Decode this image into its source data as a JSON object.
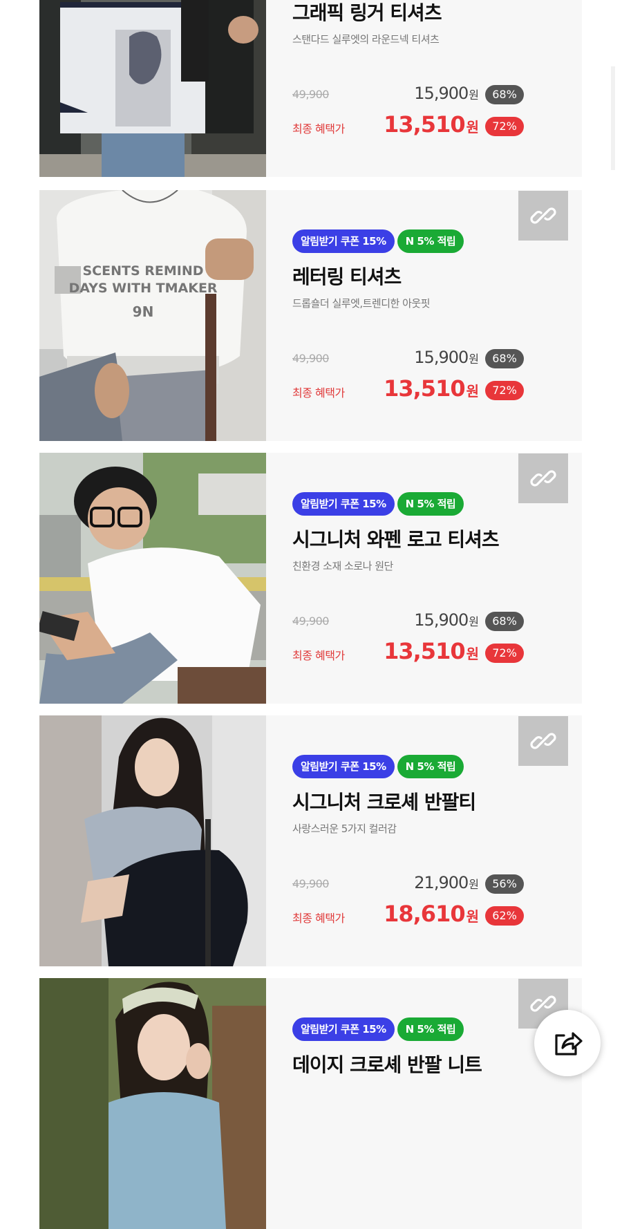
{
  "products": [
    {
      "title": "그래픽 링거 티셔츠",
      "subtitle": "스탠다드 실루엣의 라운드넥 티셔츠",
      "original_price": "49,900",
      "price": "15,900",
      "discount": "68%",
      "final_label": "최종 혜택가",
      "final_price": "13,510",
      "final_discount": "72%"
    },
    {
      "badge_coupon": "알림받기 쿠폰 15%",
      "badge_point": "N 5% 적립",
      "title": "레터링 티셔츠",
      "subtitle": "드롭숄더 실루엣,트렌디한 아웃핏",
      "shirt_print_line1": "SCENTS REMIND",
      "shirt_print_line2": "DAYS WITH TMAKER",
      "shirt_print_line3": "9N",
      "original_price": "49,900",
      "price": "15,900",
      "discount": "68%",
      "final_label": "최종 혜택가",
      "final_price": "13,510",
      "final_discount": "72%"
    },
    {
      "badge_coupon": "알림받기 쿠폰 15%",
      "badge_point": "N 5% 적립",
      "title": "시그니처 와펜 로고 티셔츠",
      "subtitle": "친환경 소재 소로나 원단",
      "original_price": "49,900",
      "price": "15,900",
      "discount": "68%",
      "final_label": "최종 혜택가",
      "final_price": "13,510",
      "final_discount": "72%"
    },
    {
      "badge_coupon": "알림받기 쿠폰 15%",
      "badge_point": "N 5% 적립",
      "title": "시그니처 크로셰 반팔티",
      "subtitle": "사랑스러운 5가지 컬러감",
      "original_price": "49,900",
      "price": "21,900",
      "discount": "56%",
      "final_label": "최종 혜택가",
      "final_price": "18,610",
      "final_discount": "62%"
    },
    {
      "badge_coupon": "알림받기 쿠폰 15%",
      "badge_point": "N 5% 적립",
      "title": "데이지 크로셰 반팔 니트"
    }
  ],
  "currency": "원",
  "icons": {
    "link": "link-icon",
    "share": "share-icon"
  },
  "colors": {
    "coupon_badge": "#3b3fe6",
    "point_badge": "#1aaa35",
    "sale_red": "#e8363a",
    "link_button": "#c4c4c4"
  }
}
